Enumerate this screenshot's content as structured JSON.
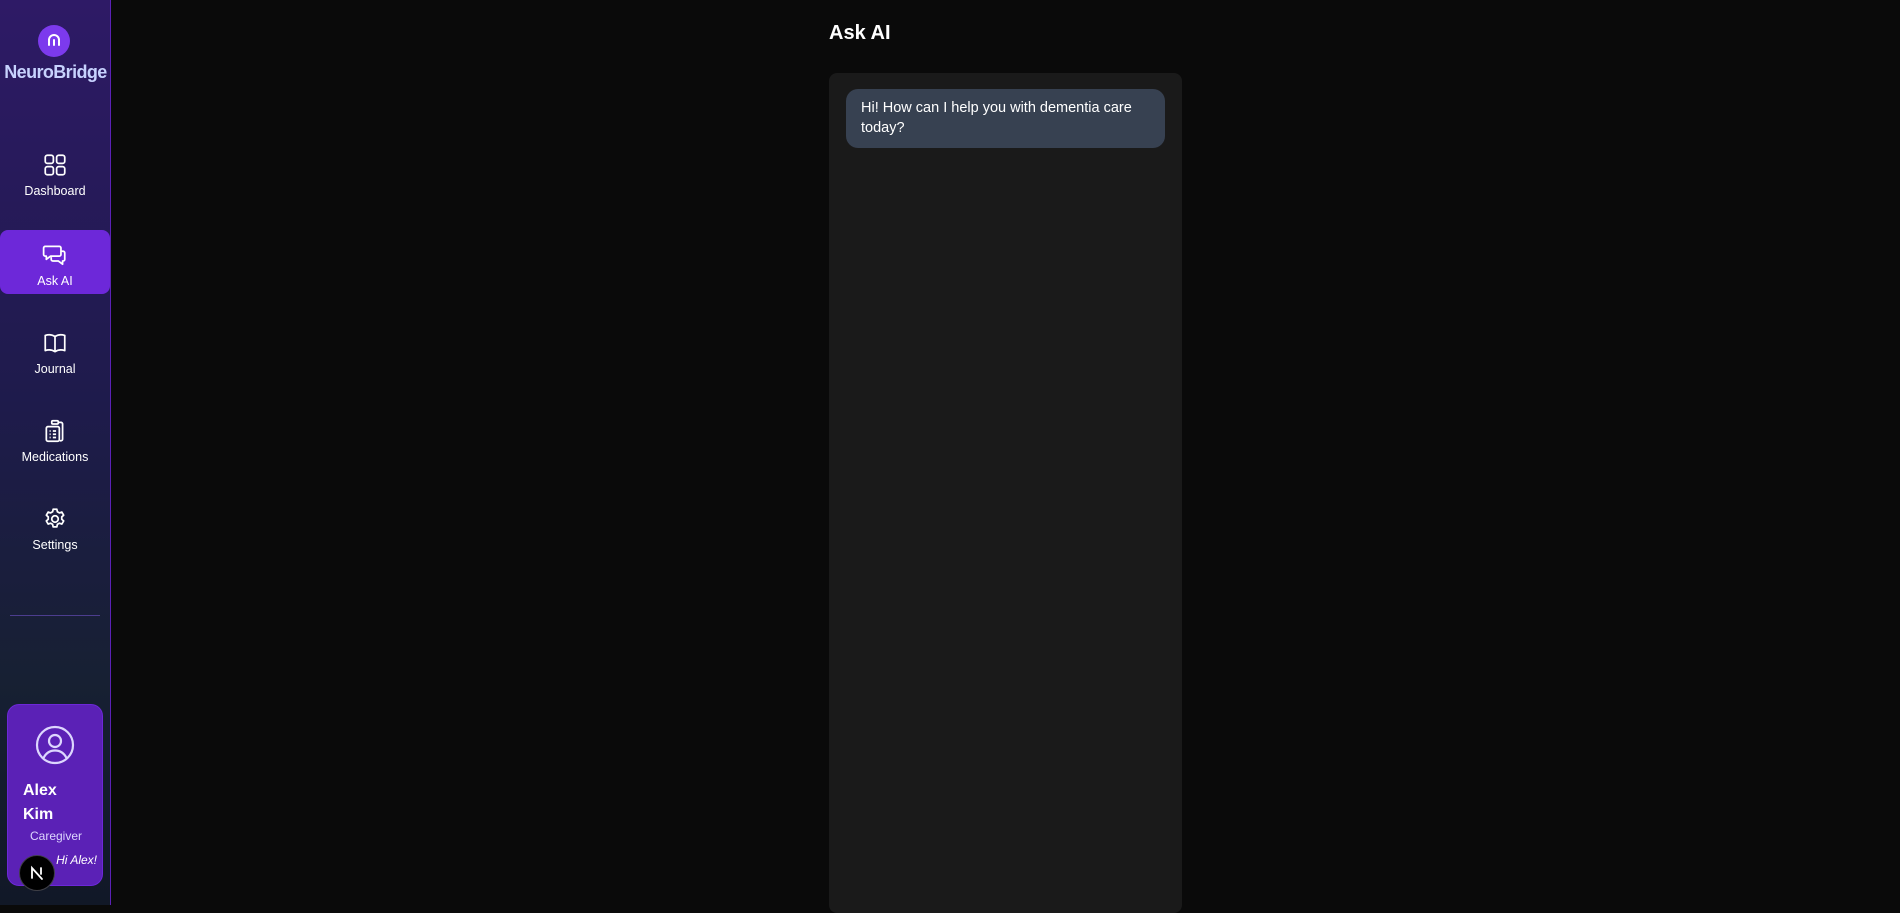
{
  "app": {
    "name": "NeuroBridge",
    "logo_icon": "brain-logo-icon"
  },
  "sidebar": {
    "items": [
      {
        "label": "Dashboard",
        "icon": "grid-icon",
        "active": false
      },
      {
        "label": "Ask AI",
        "icon": "chat-bubbles-icon",
        "active": true
      },
      {
        "label": "Journal",
        "icon": "book-open-icon",
        "active": false
      },
      {
        "label": "Medications",
        "icon": "clipboard-list-icon",
        "active": false
      },
      {
        "label": "Settings",
        "icon": "gear-icon",
        "active": false
      }
    ]
  },
  "profile": {
    "first_name": "Alex",
    "last_name": "Kim",
    "role": "Caregiver",
    "greeting": "Hi Alex!",
    "avatar_icon": "user-circle-icon"
  },
  "page": {
    "title": "Ask AI"
  },
  "chat": {
    "messages": [
      {
        "sender": "assistant",
        "text": "Hi! How can I help you with dementia care today?"
      }
    ]
  },
  "colors": {
    "accent": "#6d28d9",
    "logo_bg": "#7c3aed",
    "bubble_bg": "#374151",
    "panel_bg": "#1a1a1a",
    "page_bg": "#0a0a0a"
  }
}
